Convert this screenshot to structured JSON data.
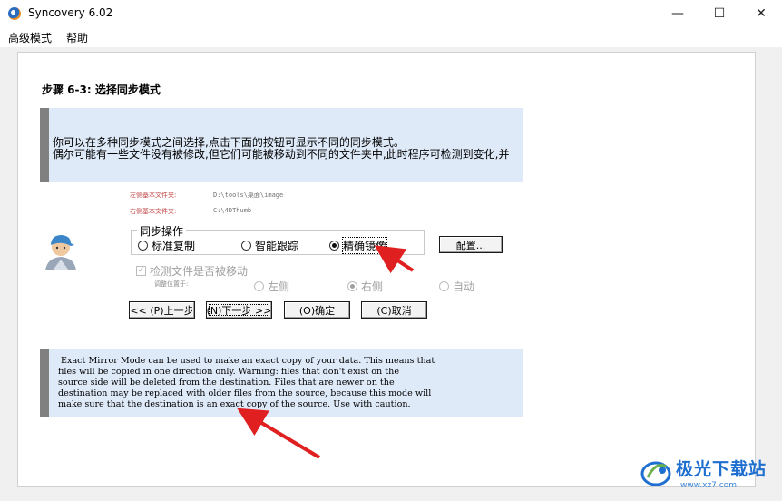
{
  "window": {
    "title": "Syncovery 6.02",
    "minimize": "—",
    "maximize": "☐",
    "close": "✕"
  },
  "menu": {
    "items": [
      "高级模式",
      "帮助"
    ]
  },
  "step": {
    "title": "步骤 6-3: 选择同步模式"
  },
  "intro": {
    "line1": "你可以在多种同步模式之间选择,点击下面的按钮可显示不同的同步模式。",
    "line2": "偶尔可能有一些文件没有被修改,但它们可能被移动到不同的文件夹中,此时程序可检测到变化,并"
  },
  "paths": {
    "left_label": "左侧基本文件夹:",
    "left_value": "D:\\tools\\桌面\\image",
    "right_label": "右侧基本文件夹:",
    "right_value": "C:\\4DThumb"
  },
  "sync_group": {
    "title": "同步操作",
    "options": [
      "标准复制",
      "智能跟踪",
      "精确镜像"
    ],
    "selected": "精确镜像",
    "config_button": "配置..."
  },
  "move_detect": {
    "checkbox_label": "检测文件是否被移动",
    "checked": true,
    "position_label": "调整位置于:",
    "options": [
      "左侧",
      "右侧",
      "自动"
    ],
    "selected": "右侧"
  },
  "nav_buttons": {
    "prev": "<< (P)上一步",
    "next": "(N)下一步 >>",
    "ok": "(O)确定",
    "cancel": "(C)取消"
  },
  "description": {
    "text": " Exact Mirror Mode can be used to make an exact copy of your data. This means that\nfiles will be copied in one direction only. Warning: files that don't exist on the\nsource side will be deleted from the destination. Files that are newer on the\ndestination may be replaced with older files from the source, because this mode will\nmake sure that the destination is an exact copy of the source. Use with caution."
  },
  "watermark": {
    "main": "极光下载站",
    "sub": "www.xz7.com"
  },
  "colors": {
    "info_bg": "#dfeaf9",
    "info_bar": "#808080",
    "arrow": "#e02020",
    "path_label": "#c04040",
    "watermark": "#1e6fd0"
  },
  "icons": {
    "app": "syncovery-app-icon",
    "avatar": "user-avatar-icon",
    "watermark_logo": "xz7-logo-icon"
  }
}
